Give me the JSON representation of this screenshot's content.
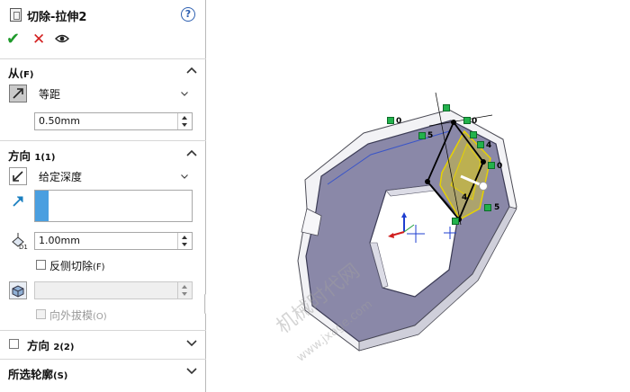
{
  "header": {
    "title": "切除-拉伸2"
  },
  "from": {
    "section_label": "从",
    "section_shortcut": "(F)",
    "condition": "等距",
    "offset_value": "0.50mm"
  },
  "direction1": {
    "section_label": "方向",
    "section_shortcut": "1(1)",
    "end_condition": "给定深度",
    "depth_value": "1.00mm",
    "flip_side_label": "反侧切除",
    "flip_side_shortcut": "(F)",
    "draft_outward_label": "向外拔模",
    "draft_outward_shortcut": "(O)"
  },
  "direction2": {
    "section_label": "方向",
    "section_shortcut": "2(2)"
  },
  "selected_contours": {
    "section_label": "所选轮廓",
    "section_shortcut": "(S)"
  },
  "viewport": {
    "watermark_cn": "机械时代网",
    "watermark_url": "www.jxage.com",
    "dim_labels": [
      "0",
      "5",
      "0",
      "4",
      "0",
      "4",
      "5"
    ]
  },
  "colors": {
    "accent_blue": "#4a9fe0",
    "model_face": "#8a88a8",
    "preview_yellow": "#e6d200",
    "relation_green": "#22b24c"
  }
}
